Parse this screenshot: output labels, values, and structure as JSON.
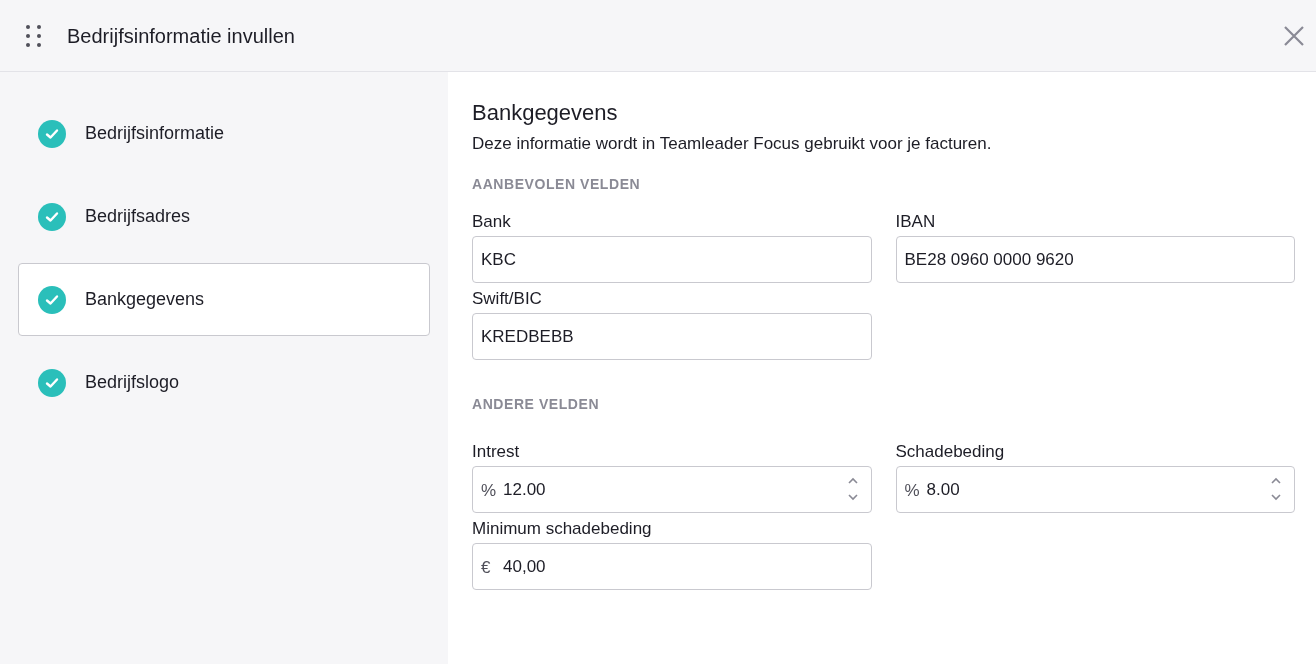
{
  "window": {
    "title": "Bedrijfsinformatie invullen"
  },
  "steps": [
    {
      "label": "Bedrijfsinformatie",
      "completed": true,
      "selected": false
    },
    {
      "label": "Bedrijfsadres",
      "completed": true,
      "selected": false
    },
    {
      "label": "Bankgegevens",
      "completed": true,
      "selected": true
    },
    {
      "label": "Bedrijfslogo",
      "completed": true,
      "selected": false
    }
  ],
  "content": {
    "title": "Bankgegevens",
    "description": "Deze informatie wordt in Teamleader Focus gebruikt voor je facturen.",
    "sections": [
      {
        "heading": "AANBEVOLEN VELDEN",
        "rows": [
          [
            {
              "label": "Bank",
              "kind": "text",
              "value": "KBC"
            },
            {
              "label": "IBAN",
              "kind": "text",
              "value": "BE28 0960 0000 9620"
            }
          ],
          [
            {
              "label": "Swift/BIC",
              "kind": "text",
              "value": "KREDBEBB"
            }
          ]
        ]
      },
      {
        "heading": "ANDERE VELDEN",
        "rows": [
          [
            {
              "label": "Intrest",
              "kind": "number",
              "prefix": "%",
              "value": "12.00"
            },
            {
              "label": "Schadebeding",
              "kind": "number",
              "prefix": "%",
              "value": "8.00"
            }
          ],
          [
            {
              "label": "Minimum schadebeding",
              "kind": "text",
              "prefix": "€",
              "value": "40,00"
            }
          ]
        ]
      }
    ]
  }
}
